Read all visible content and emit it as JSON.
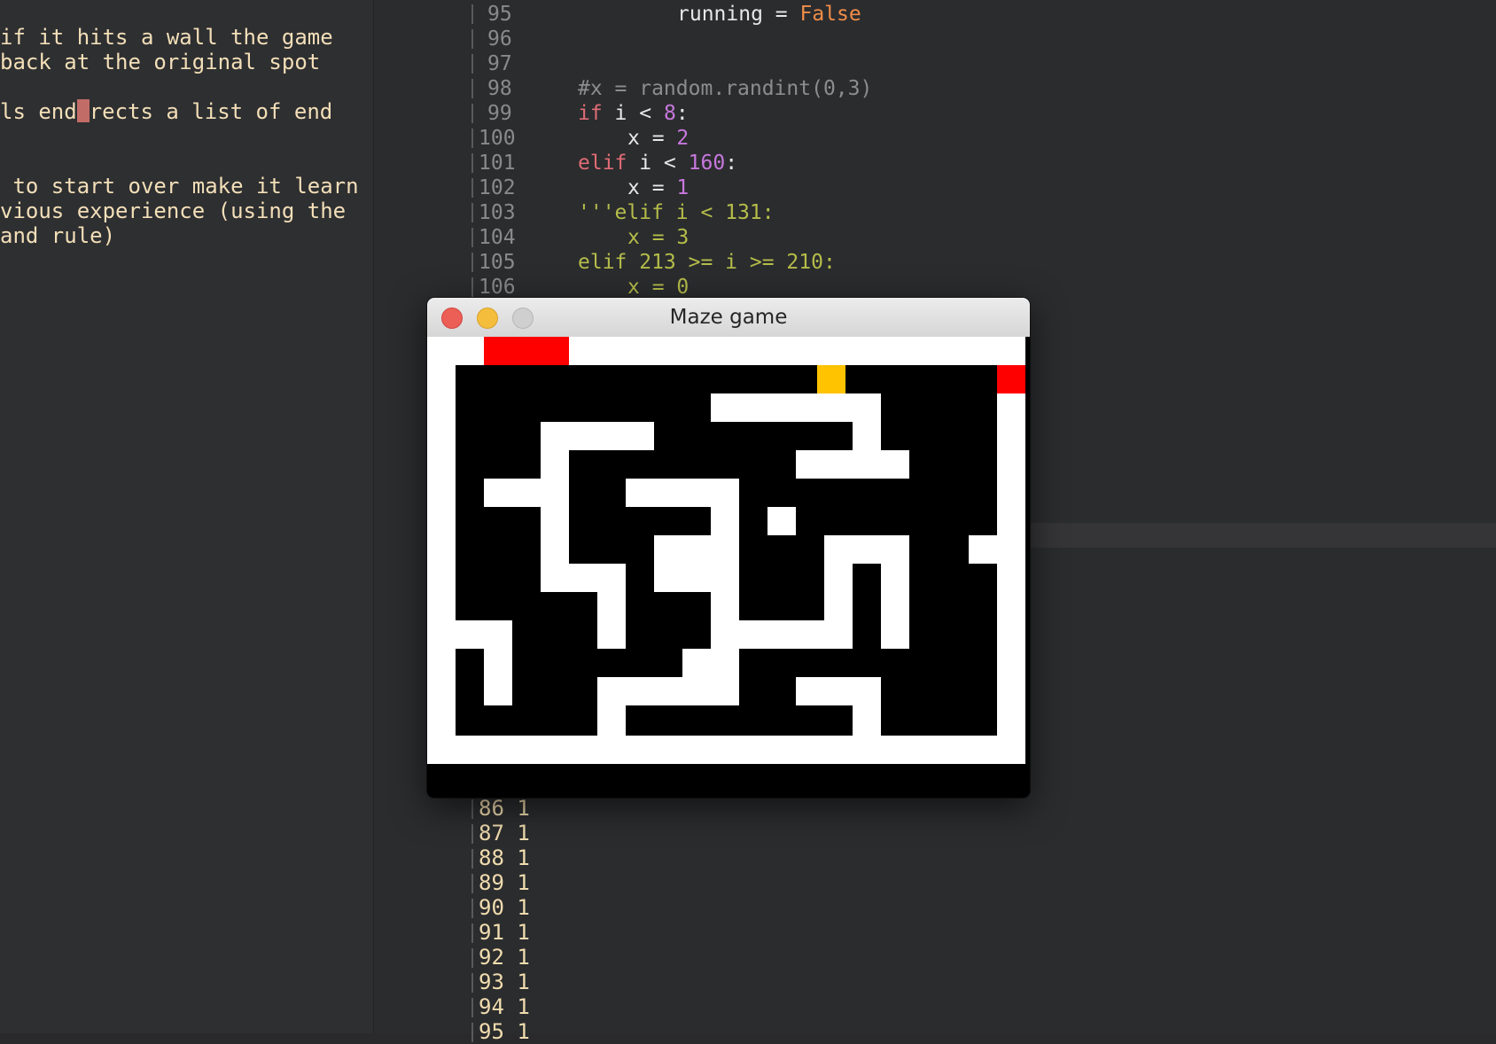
{
  "notes": {
    "lines": [
      "if it hits a wall the game",
      "back at the original spot",
      "",
      "ls end",
      "",
      "",
      " to start over make it learn",
      "vious experience (using the",
      "and rule)"
    ],
    "cursor_line_rest": "rects a list of end"
  },
  "editor": {
    "code_lines": [
      {
        "num": "95",
        "text": "running = False"
      },
      {
        "num": "96",
        "text": ""
      },
      {
        "num": "97",
        "text": ""
      },
      {
        "num": "98",
        "text": "#x = random.randint(0,3)"
      },
      {
        "num": "99",
        "text": "if i < 8:"
      },
      {
        "num": "100",
        "text": "x = 2"
      },
      {
        "num": "101",
        "text": "elif i < 160:"
      },
      {
        "num": "102",
        "text": "x = 1"
      },
      {
        "num": "103",
        "text": "'''elif i < 131:"
      },
      {
        "num": "104",
        "text": "x = 3"
      },
      {
        "num": "105",
        "text": "elif 213 >= i >= 210:"
      },
      {
        "num": "106",
        "text": "x = 0"
      }
    ],
    "output_lines": [
      "86 1",
      "87 1",
      "88 1",
      "89 1",
      "90 1",
      "91 1",
      "92 1",
      "93 1",
      "94 1",
      "95 1"
    ]
  },
  "window": {
    "title": "Maze game",
    "colors": {
      "wall": "#ffffff",
      "path": "#000000",
      "goal": "#ff0000",
      "player": "#ffc300"
    }
  }
}
